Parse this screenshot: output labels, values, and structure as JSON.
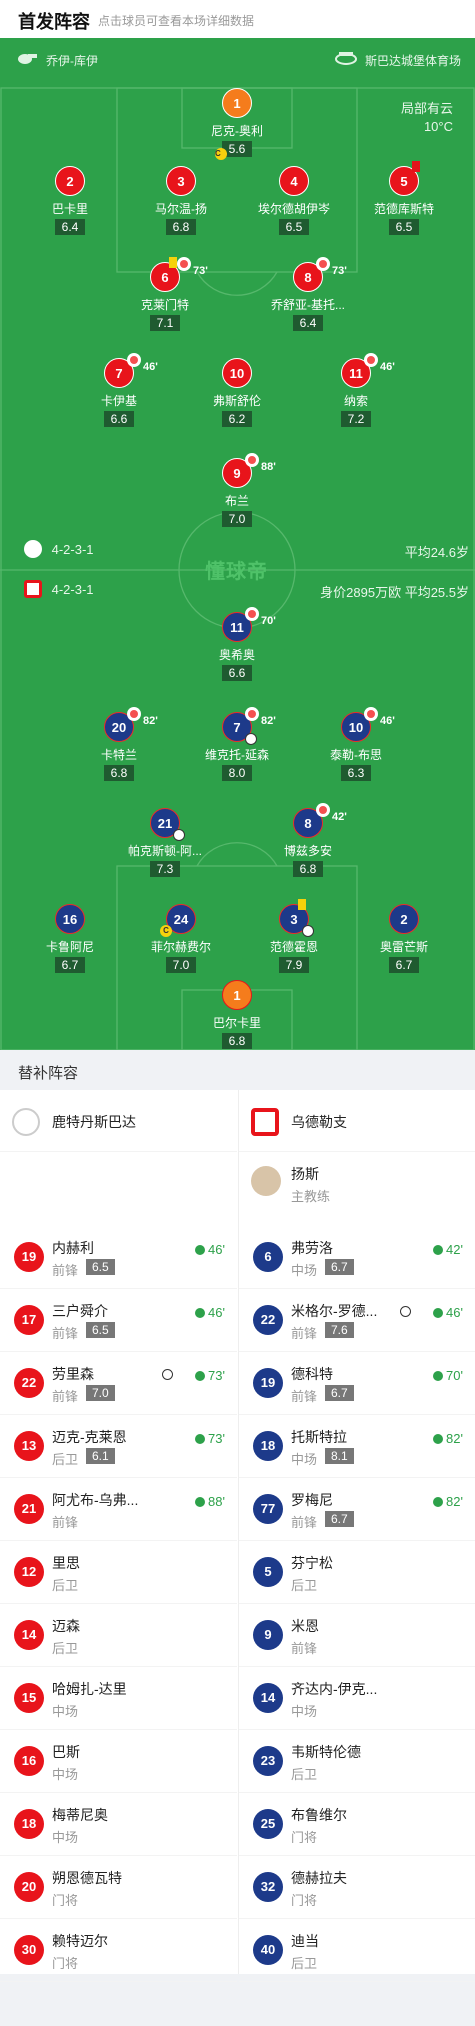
{
  "header": {
    "title": "首发阵容",
    "subtitle": "点击球员可查看本场详细数据"
  },
  "pitch": {
    "home_coach": "乔伊-库伊",
    "stadium": "斯巴达城堡体育场",
    "weather": "局部有云",
    "temperature": "10°C",
    "home_formation": "4-2-3-1",
    "home_avg_age": "平均24.6岁",
    "away_formation": "4-2-3-1",
    "away_value_age": "身价2895万欧 平均25.5岁",
    "watermark": "懂球帝"
  },
  "home_players": [
    {
      "num": "1",
      "name": "尼克-奥利",
      "rating": "5.6",
      "minute": ""
    },
    {
      "num": "2",
      "name": "巴卡里",
      "rating": "6.4",
      "minute": ""
    },
    {
      "num": "3",
      "name": "马尔温-扬",
      "rating": "6.8",
      "minute": ""
    },
    {
      "num": "4",
      "name": "埃尔德胡伊岑",
      "rating": "6.5",
      "minute": ""
    },
    {
      "num": "5",
      "name": "范德库斯特",
      "rating": "6.5",
      "minute": ""
    },
    {
      "num": "6",
      "name": "克莱门特",
      "rating": "7.1",
      "minute": "73'"
    },
    {
      "num": "8",
      "name": "乔舒亚-基托...",
      "rating": "6.4",
      "minute": "73'"
    },
    {
      "num": "7",
      "name": "卡伊基",
      "rating": "6.6",
      "minute": "46'"
    },
    {
      "num": "10",
      "name": "弗斯舒伦",
      "rating": "6.2",
      "minute": ""
    },
    {
      "num": "11",
      "name": "纳索",
      "rating": "7.2",
      "minute": "46'"
    },
    {
      "num": "9",
      "name": "布兰",
      "rating": "7.0",
      "minute": "88'"
    }
  ],
  "away_players": [
    {
      "num": "11",
      "name": "奥希奥",
      "rating": "6.6",
      "minute": "70'"
    },
    {
      "num": "20",
      "name": "卡特兰",
      "rating": "6.8",
      "minute": "82'"
    },
    {
      "num": "7",
      "name": "维克托-延森",
      "rating": "8.0",
      "minute": "82'"
    },
    {
      "num": "10",
      "name": "泰勒-布思",
      "rating": "6.3",
      "minute": "46'"
    },
    {
      "num": "21",
      "name": "帕克斯顿-阿...",
      "rating": "7.3",
      "minute": ""
    },
    {
      "num": "8",
      "name": "博兹多安",
      "rating": "6.8",
      "minute": "42'"
    },
    {
      "num": "16",
      "name": "卡鲁阿尼",
      "rating": "6.7",
      "minute": ""
    },
    {
      "num": "24",
      "name": "菲尔赫费尔",
      "rating": "7.0",
      "minute": ""
    },
    {
      "num": "3",
      "name": "范德霍恩",
      "rating": "7.9",
      "minute": ""
    },
    {
      "num": "2",
      "name": "奥雷芒斯",
      "rating": "6.7",
      "minute": ""
    },
    {
      "num": "1",
      "name": "巴尔卡里",
      "rating": "6.8",
      "minute": ""
    }
  ],
  "subs": {
    "title": "替补阵容",
    "home_team": "鹿特丹斯巴达",
    "away_team": "乌德勒支",
    "away_coach": {
      "name": "扬斯",
      "role": "主教练"
    },
    "home": [
      {
        "num": "19",
        "name": "内赫利",
        "pos": "前锋",
        "score": "6.5",
        "on": "46'"
      },
      {
        "num": "17",
        "name": "三户舜介",
        "pos": "前锋",
        "score": "6.5",
        "on": "46'"
      },
      {
        "num": "22",
        "name": "劳里森",
        "pos": "前锋",
        "score": "7.0",
        "on": "73'"
      },
      {
        "num": "13",
        "name": "迈克-克莱恩",
        "pos": "后卫",
        "score": "6.1",
        "on": "73'"
      },
      {
        "num": "21",
        "name": "阿尤布-乌弗...",
        "pos": "前锋",
        "score": "",
        "on": "88'"
      },
      {
        "num": "12",
        "name": "里思",
        "pos": "后卫",
        "score": "",
        "on": ""
      },
      {
        "num": "14",
        "name": "迈森",
        "pos": "后卫",
        "score": "",
        "on": ""
      },
      {
        "num": "15",
        "name": "哈姆扎-达里",
        "pos": "中场",
        "score": "",
        "on": ""
      },
      {
        "num": "16",
        "name": "巴斯",
        "pos": "中场",
        "score": "",
        "on": ""
      },
      {
        "num": "18",
        "name": "梅蒂尼奥",
        "pos": "中场",
        "score": "",
        "on": ""
      },
      {
        "num": "20",
        "name": "朔恩德瓦特",
        "pos": "门将",
        "score": "",
        "on": ""
      },
      {
        "num": "30",
        "name": "赖特迈尔",
        "pos": "门将",
        "score": "",
        "on": ""
      }
    ],
    "away": [
      {
        "num": "6",
        "name": "弗劳洛",
        "pos": "中场",
        "score": "6.7",
        "on": "42'"
      },
      {
        "num": "22",
        "name": "米格尔-罗德...",
        "pos": "前锋",
        "score": "7.6",
        "on": "46'"
      },
      {
        "num": "19",
        "name": "德科特",
        "pos": "前锋",
        "score": "6.7",
        "on": "70'"
      },
      {
        "num": "18",
        "name": "托斯特拉",
        "pos": "中场",
        "score": "8.1",
        "on": "82'"
      },
      {
        "num": "77",
        "name": "罗梅尼",
        "pos": "前锋",
        "score": "6.7",
        "on": "82'"
      },
      {
        "num": "5",
        "name": "芬宁松",
        "pos": "后卫",
        "score": "",
        "on": ""
      },
      {
        "num": "9",
        "name": "米恩",
        "pos": "前锋",
        "score": "",
        "on": ""
      },
      {
        "num": "14",
        "name": "齐达内-伊克...",
        "pos": "中场",
        "score": "",
        "on": ""
      },
      {
        "num": "23",
        "name": "韦斯特伦德",
        "pos": "后卫",
        "score": "",
        "on": ""
      },
      {
        "num": "25",
        "name": "布鲁维尔",
        "pos": "门将",
        "score": "",
        "on": ""
      },
      {
        "num": "32",
        "name": "德赫拉夫",
        "pos": "门将",
        "score": "",
        "on": ""
      },
      {
        "num": "40",
        "name": "迪当",
        "pos": "后卫",
        "score": "",
        "on": ""
      }
    ]
  },
  "colors": {
    "pitch": "#2da14a",
    "home": "#e8141b",
    "away": "#1d3a8a",
    "sub_green": "#2da14a"
  }
}
